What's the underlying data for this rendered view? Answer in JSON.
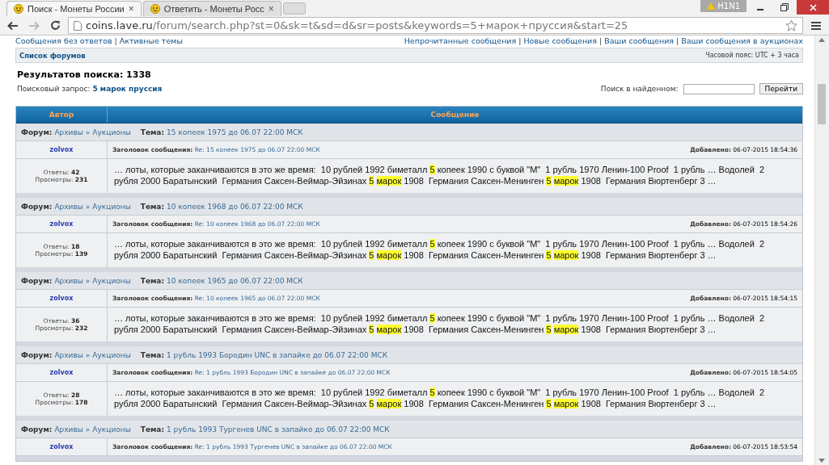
{
  "browser": {
    "tabs": [
      {
        "title": "Поиск - Монеты России",
        "selected": true,
        "close": "×"
      },
      {
        "title": "Ответить - Монеты Росс",
        "selected": false,
        "close": "×"
      }
    ],
    "url_host": "coins.lave.ru",
    "url_path": "/forum/search.php?st=0&sk=t&sd=d&sr=posts&keywords=5+марок+пруссия&start=25",
    "badge": "H1N1"
  },
  "link_separator": "|",
  "top_links_left": [
    "Сообщения без ответов",
    "Активные темы"
  ],
  "top_links_right": [
    "Непрочитанные сообщения",
    "Новые сообщения",
    "Ваши сообщения",
    "Ваши сообщения в аукционах"
  ],
  "nav_bar": {
    "link": "Список форумов",
    "timezone": "Часовой пояс: UTC + 3 часа"
  },
  "results_title": "Результатов поиска: 1338",
  "query_label": "Поисковый запрос:",
  "query": "5 марок пруссия",
  "search_within": {
    "label": "Поиск в найденном:",
    "button": "Перейти"
  },
  "table": {
    "columns": [
      "Автор",
      "Сообщение"
    ],
    "results": [
      {
        "forum_label": "Форум:",
        "forum": [
          "Архивы",
          "Аукционы"
        ],
        "forum_separator": "»",
        "topic_label": "Тема:",
        "topic": "15 копеек 1975 до 06.07 22:00 МСК",
        "author": "zolvox",
        "subject_label": "Заголовок сообщения:",
        "subject": "Re: 15 копеек 1975 до 06.07 22:00 МСК",
        "date_label": "Добавлено:",
        "date": "06-07-2015 18:54:36",
        "replies_label": "Ответы:",
        "replies": "42",
        "views_label": "Просмотры:",
        "views": "231",
        "excerpt": [
          {
            "text": "… лоты, которые заканчиваются в это же время:  10 рублей 1992 биметалл ",
            "highlight": false
          },
          {
            "text": "5",
            "highlight": true
          },
          {
            "text": " копеек 1990 с буквой \"М\"  1 рубль 1970 Ленин-100 Proof  1 рубль … Водолей  2 рубля 2000 Баратынский  Германия Саксен-Веймар-Эйзинах ",
            "highlight": false
          },
          {
            "text": "5 марок",
            "highlight": true
          },
          {
            "text": " 1908  Германия Саксен-Менинген ",
            "highlight": false
          },
          {
            "text": "5 марок",
            "highlight": true
          },
          {
            "text": " 1908  Германия Вюртенберг 3 …",
            "highlight": false
          }
        ]
      },
      {
        "forum_label": "Форум:",
        "forum": [
          "Архивы",
          "Аукционы"
        ],
        "forum_separator": "»",
        "topic_label": "Тема:",
        "topic": "10 копеек 1968 до 06.07 22:00 МСК",
        "author": "zolvox",
        "subject_label": "Заголовок сообщения:",
        "subject": "Re: 10 копеек 1968 до 06.07 22:00 МСК",
        "date_label": "Добавлено:",
        "date": "06-07-2015 18:54:26",
        "replies_label": "Ответы:",
        "replies": "18",
        "views_label": "Просмотры:",
        "views": "139",
        "excerpt": [
          {
            "text": "… лоты, которые заканчиваются в это же время:  10 рублей 1992 биметалл ",
            "highlight": false
          },
          {
            "text": "5",
            "highlight": true
          },
          {
            "text": " копеек 1990 с буквой \"М\"  1 рубль 1970 Ленин-100 Proof  1 рубль … Водолей  2 рубля 2000 Баратынский  Германия Саксен-Веймар-Эйзинах ",
            "highlight": false
          },
          {
            "text": "5 марок",
            "highlight": true
          },
          {
            "text": " 1908  Германия Саксен-Менинген ",
            "highlight": false
          },
          {
            "text": "5 марок",
            "highlight": true
          },
          {
            "text": " 1908  Германия Вюртенберг 3 …",
            "highlight": false
          }
        ]
      },
      {
        "forum_label": "Форум:",
        "forum": [
          "Архивы",
          "Аукционы"
        ],
        "forum_separator": "»",
        "topic_label": "Тема:",
        "topic": "10 копеек 1965 до 06.07 22:00 МСК",
        "author": "zolvox",
        "subject_label": "Заголовок сообщения:",
        "subject": "Re: 10 копеек 1965 до 06.07 22:00 МСК",
        "date_label": "Добавлено:",
        "date": "06-07-2015 18:54:15",
        "replies_label": "Ответы:",
        "replies": "36",
        "views_label": "Просмотры:",
        "views": "232",
        "excerpt": [
          {
            "text": "… лоты, которые заканчиваются в это же время:  10 рублей 1992 биметалл ",
            "highlight": false
          },
          {
            "text": "5",
            "highlight": true
          },
          {
            "text": " копеек 1990 с буквой \"М\"  1 рубль 1970 Ленин-100 Proof  1 рубль … Водолей  2 рубля 2000 Баратынский  Германия Саксен-Веймар-Эйзинах ",
            "highlight": false
          },
          {
            "text": "5 марок",
            "highlight": true
          },
          {
            "text": " 1908  Германия Саксен-Менинген ",
            "highlight": false
          },
          {
            "text": "5 марок",
            "highlight": true
          },
          {
            "text": " 1908  Германия Вюртенберг 3 …",
            "highlight": false
          }
        ]
      },
      {
        "forum_label": "Форум:",
        "forum": [
          "Архивы",
          "Аукционы"
        ],
        "forum_separator": "»",
        "topic_label": "Тема:",
        "topic": "1 рубль 1993 Бородин UNC в запайке до 06.07 22:00 МСК",
        "author": "zolvox",
        "subject_label": "Заголовок сообщения:",
        "subject": "Re: 1 рубль 1993 Бородин UNC в запайке до 06.07 22:00 МСК",
        "date_label": "Добавлено:",
        "date": "06-07-2015 18:54:05",
        "replies_label": "Ответы:",
        "replies": "28",
        "views_label": "Просмотры:",
        "views": "178",
        "excerpt": [
          {
            "text": "… лоты, которые заканчиваются в это же время:  10 рублей 1992 биметалл ",
            "highlight": false
          },
          {
            "text": "5",
            "highlight": true
          },
          {
            "text": " копеек 1990 с буквой \"М\"  1 рубль 1970 Ленин-100 Proof  1 рубль … Водолей  2 рубля 2000 Баратынский  Германия Саксен-Веймар-Эйзинах ",
            "highlight": false
          },
          {
            "text": "5 марок",
            "highlight": true
          },
          {
            "text": " 1908  Германия Саксен-Менинген ",
            "highlight": false
          },
          {
            "text": "5 марок",
            "highlight": true
          },
          {
            "text": " 1908  Германия Вюртенберг 3 …",
            "highlight": false
          }
        ]
      },
      {
        "forum_label": "Форум:",
        "forum": [
          "Архивы",
          "Аукционы"
        ],
        "forum_separator": "»",
        "topic_label": "Тема:",
        "topic": "1 рубль 1993 Тургенев UNC в запайке до 06.07 22:00 МСК",
        "author": "zolvox",
        "subject_label": "Заголовок сообщения:",
        "subject": "Re: 1 рубль 1993 Тургенев UNC в запайке до 06.07 22:00 МСК",
        "date_label": "Добавлено:",
        "date": "06-07-2015 18:53:54"
      }
    ]
  }
}
